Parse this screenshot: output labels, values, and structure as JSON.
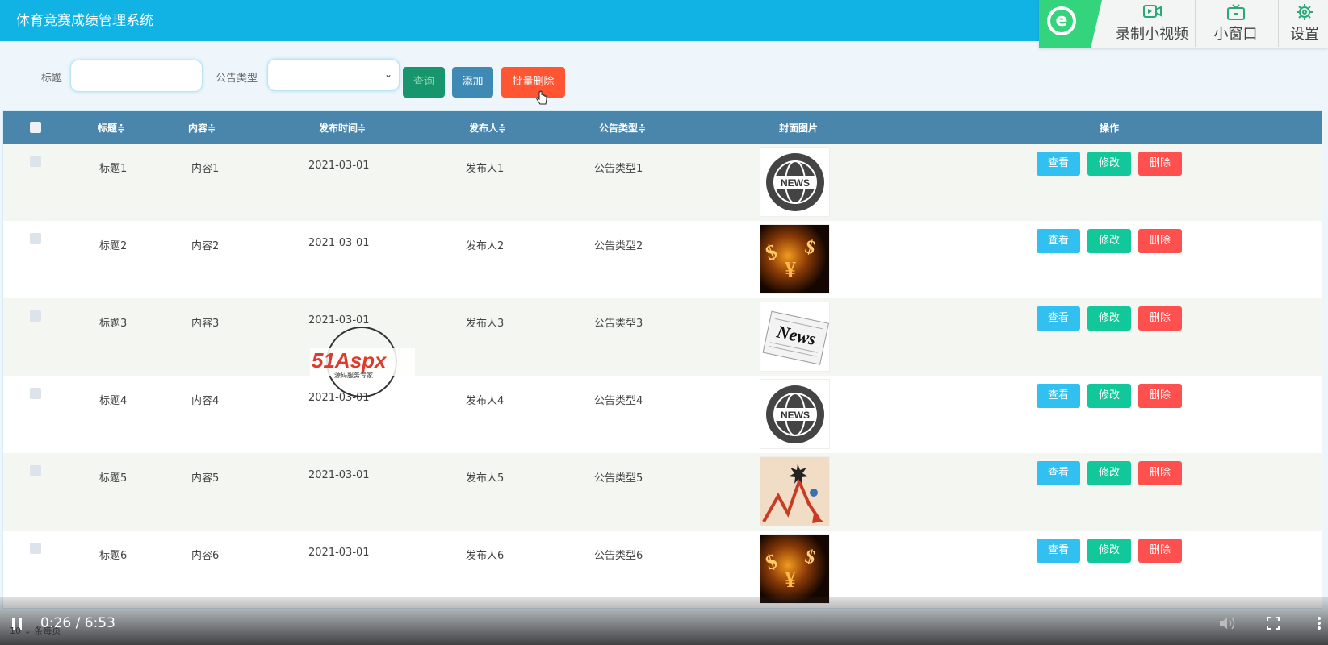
{
  "app": {
    "title": "体育竞赛成绩管理系统"
  },
  "toolbar_ext": {
    "record_label": "录制小视频",
    "window_label": "小窗口",
    "settings_label": "设置"
  },
  "search": {
    "title_label": "标题",
    "title_value": "",
    "type_label": "公告类型",
    "type_value": "",
    "search_button": "查询",
    "add_button": "添加",
    "batch_delete_button": "批量删除"
  },
  "table": {
    "columns": [
      "标题",
      "内容",
      "发布时间",
      "发布人",
      "公告类型",
      "封面图片",
      "操作"
    ],
    "sort_marker": "≑",
    "actions": {
      "view": "查看",
      "edit": "修改",
      "delete": "删除"
    },
    "rows": [
      {
        "title": "标题1",
        "content": "内容1",
        "date": "2021-03-01",
        "publisher": "发布人1",
        "type": "公告类型1",
        "cover": "news-globe"
      },
      {
        "title": "标题2",
        "content": "内容2",
        "date": "2021-03-01",
        "publisher": "发布人2",
        "type": "公告类型2",
        "cover": "money-fire"
      },
      {
        "title": "标题3",
        "content": "内容3",
        "date": "2021-03-01",
        "publisher": "发布人3",
        "type": "公告类型3",
        "cover": "news-paper"
      },
      {
        "title": "标题4",
        "content": "内容4",
        "date": "2021-03-01",
        "publisher": "发布人4",
        "type": "公告类型4",
        "cover": "news-globe"
      },
      {
        "title": "标题5",
        "content": "内容5",
        "date": "2021-03-01",
        "publisher": "发布人5",
        "type": "公告类型5",
        "cover": "chart-down"
      },
      {
        "title": "标题6",
        "content": "内容6",
        "date": "2021-03-01",
        "publisher": "发布人6",
        "type": "公告类型6",
        "cover": "money-fire"
      }
    ]
  },
  "watermark": {
    "brand": "51Aspx",
    "tagline": "源码服务专家"
  },
  "video": {
    "time": "0:26 / 6:53"
  },
  "pager": {
    "page_size": "10",
    "label": "条每页"
  },
  "colors": {
    "header": "#10b3e3",
    "table_head": "#4a86ac",
    "view": "#32c0f0",
    "edit": "#12c89a",
    "delete": "#ff5050"
  }
}
